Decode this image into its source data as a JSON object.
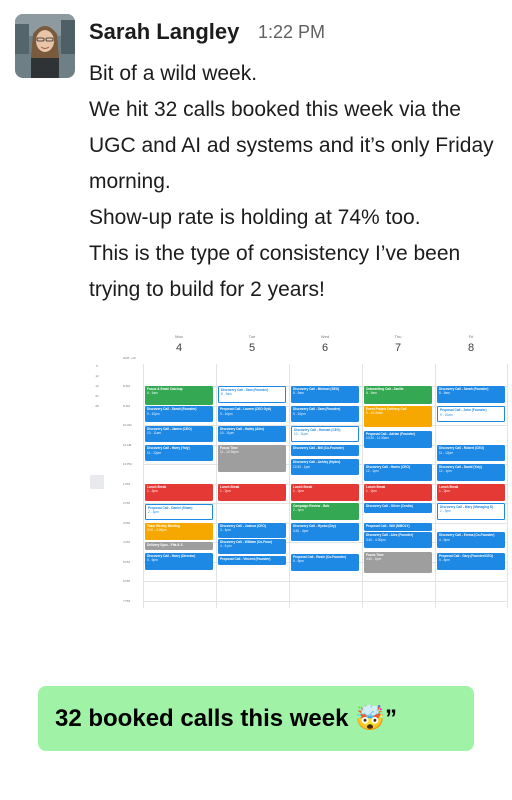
{
  "message": {
    "sender": "Sarah Langley",
    "time": "1:22 PM",
    "lines": [
      "Bit of a wild week.",
      "We hit 32 calls booked this week via the UGC and AI ad systems and it’s only Friday morning.",
      "Show-up rate is holding at 74% too.",
      "This is the type of consistency I’ve been trying to build for 2 years!"
    ]
  },
  "calendar": {
    "gmt_label": "GMT +10",
    "mini_dates": [
      "5",
      "12",
      "14",
      "21",
      "28"
    ],
    "days": [
      {
        "dow": "Mon",
        "num": "4"
      },
      {
        "dow": "Tue",
        "num": "5"
      },
      {
        "dow": "Wed",
        "num": "6"
      },
      {
        "dow": "Thu",
        "num": "7"
      },
      {
        "dow": "Fri",
        "num": "8"
      }
    ],
    "hours": [
      "8 AM",
      "9 AM",
      "10 AM",
      "11 AM",
      "12 PM",
      "1 PM",
      "2 PM",
      "3 PM",
      "4 PM",
      "5 PM",
      "6 PM",
      "7 PM"
    ],
    "colors": {
      "blue": "#1e88e5",
      "green": "#34a853",
      "red": "#e53935",
      "orange": "#f6a800",
      "gray": "#9e9e9e"
    },
    "events": [
      {
        "day": 0,
        "start": 8.0,
        "end": 8.95,
        "color": "green",
        "outline": false,
        "title": "Focus & Email Catchup",
        "sub": "8 - 9am"
      },
      {
        "day": 0,
        "start": 9.05,
        "end": 9.85,
        "color": "blue",
        "outline": false,
        "title": "Discovery Call - Sarah (Founder)",
        "sub": "9 - 10pm"
      },
      {
        "day": 0,
        "start": 10.05,
        "end": 10.85,
        "color": "blue",
        "outline": false,
        "title": "Discovery Call - James (CEO)",
        "sub": "10 - 11am"
      },
      {
        "day": 0,
        "start": 11.05,
        "end": 11.85,
        "color": "blue",
        "outline": false,
        "title": "Discovery Call - Harry (Yoly)",
        "sub": "11 - 12pm"
      },
      {
        "day": 0,
        "start": 13.0,
        "end": 13.9,
        "color": "red",
        "outline": false,
        "title": "Lunch Break",
        "sub": "1 - 2pm"
      },
      {
        "day": 0,
        "start": 14.05,
        "end": 14.85,
        "color": "blue",
        "outline": true,
        "title": "Proposal Call - Daniel (Sham)",
        "sub": "2 - 3pm"
      },
      {
        "day": 0,
        "start": 15.0,
        "end": 15.9,
        "color": "orange",
        "outline": false,
        "title": "Team Weekly Meeting",
        "sub": "3:00 - 4:00pm"
      },
      {
        "day": 0,
        "start": 16.0,
        "end": 16.4,
        "color": "gray",
        "outline": false,
        "title": "Delivery Sync - Fifa & S",
        "sub": ""
      },
      {
        "day": 0,
        "start": 16.55,
        "end": 17.45,
        "color": "blue",
        "outline": false,
        "title": "Discovery Call - Harry (Director)",
        "sub": "5 - 6pm"
      },
      {
        "day": 1,
        "start": 8.0,
        "end": 8.85,
        "color": "blue",
        "outline": true,
        "title": "Discovery Call - Sam (Founder)",
        "sub": "8 - 9am"
      },
      {
        "day": 1,
        "start": 9.05,
        "end": 9.85,
        "color": "blue",
        "outline": false,
        "title": "Proposal Call - Lauren (CEO Gyb)",
        "sub": "9 - 10pm"
      },
      {
        "day": 1,
        "start": 10.05,
        "end": 10.85,
        "color": "blue",
        "outline": false,
        "title": "Discovery Call - Hailey (Alex)",
        "sub": "10 - 11pm"
      },
      {
        "day": 1,
        "start": 11.0,
        "end": 12.4,
        "color": "gray",
        "outline": false,
        "title": "Focus Time",
        "sub": "11 - 12:30pm"
      },
      {
        "day": 1,
        "start": 13.0,
        "end": 13.9,
        "color": "red",
        "outline": false,
        "title": "Lunch Break",
        "sub": "1 - 2pm"
      },
      {
        "day": 1,
        "start": 15.0,
        "end": 15.8,
        "color": "blue",
        "outline": false,
        "title": "Discovery Call - Joshua (CEO)",
        "sub": "3 - 4pm"
      },
      {
        "day": 1,
        "start": 15.85,
        "end": 16.6,
        "color": "blue",
        "outline": false,
        "title": "Discovery Call - William (Co-Foun)",
        "sub": "4 - 5 pm"
      },
      {
        "day": 1,
        "start": 16.7,
        "end": 17.2,
        "color": "blue",
        "outline": false,
        "title": "Proposal Call - Vincent (Founder)",
        "sub": ""
      },
      {
        "day": 2,
        "start": 8.0,
        "end": 8.85,
        "color": "blue",
        "outline": false,
        "title": "Discovery Call - Michael (SEO)",
        "sub": "8 - 9am"
      },
      {
        "day": 2,
        "start": 9.05,
        "end": 9.85,
        "color": "blue",
        "outline": false,
        "title": "Discovery Call - Sam (Founder)",
        "sub": "9 - 10pm"
      },
      {
        "day": 2,
        "start": 10.05,
        "end": 10.85,
        "color": "blue",
        "outline": true,
        "title": "Discovery Call - Hannah (CEO)",
        "sub": "10 - 11pm"
      },
      {
        "day": 2,
        "start": 11.05,
        "end": 11.6,
        "color": "blue",
        "outline": false,
        "title": "Discovery Call - Bill (Co-Founder)",
        "sub": ""
      },
      {
        "day": 2,
        "start": 11.75,
        "end": 12.55,
        "color": "blue",
        "outline": false,
        "title": "Discovery Call - Ashley (Hydro)",
        "sub": "12:30 - 1pm"
      },
      {
        "day": 2,
        "start": 13.0,
        "end": 13.9,
        "color": "red",
        "outline": false,
        "title": "Lunch Break",
        "sub": "1 - 2pm"
      },
      {
        "day": 2,
        "start": 14.0,
        "end": 14.85,
        "color": "green",
        "outline": false,
        "title": "Campaign Review - Bob",
        "sub": "2 - 3pm"
      },
      {
        "day": 2,
        "start": 15.05,
        "end": 15.95,
        "color": "blue",
        "outline": false,
        "title": "Discovery Call - Hyuko (Dry)",
        "sub": "3:30 - 4pm"
      },
      {
        "day": 2,
        "start": 16.6,
        "end": 17.5,
        "color": "blue",
        "outline": false,
        "title": "Proposal Call - Rosie (Co-Founder)",
        "sub": "5 - 6pm"
      },
      {
        "day": 3,
        "start": 8.0,
        "end": 8.9,
        "color": "green",
        "outline": false,
        "title": "Onboarding Call - Zacille",
        "sub": "8 - 9am"
      },
      {
        "day": 3,
        "start": 9.0,
        "end": 10.1,
        "color": "orange",
        "outline": false,
        "title": "Event Project Delivery Call",
        "sub": "9 - 10:30am"
      },
      {
        "day": 3,
        "start": 10.3,
        "end": 11.2,
        "color": "blue",
        "outline": false,
        "title": "Proposal Call - Adrian (Founder)",
        "sub": "10:30 - 11:30am"
      },
      {
        "day": 3,
        "start": 12.0,
        "end": 12.85,
        "color": "blue",
        "outline": false,
        "title": "Discovery Call - Harris (CEO)",
        "sub": "12 - 1pm"
      },
      {
        "day": 3,
        "start": 13.0,
        "end": 13.9,
        "color": "red",
        "outline": false,
        "title": "Lunch Break",
        "sub": "1 - 2pm"
      },
      {
        "day": 3,
        "start": 14.0,
        "end": 14.5,
        "color": "blue",
        "outline": false,
        "title": "Discovery Call - Oliver (Credia)",
        "sub": ""
      },
      {
        "day": 3,
        "start": 15.0,
        "end": 15.45,
        "color": "blue",
        "outline": false,
        "title": "Proposal Call - Will (NIBOLY)",
        "sub": ""
      },
      {
        "day": 3,
        "start": 15.5,
        "end": 16.3,
        "color": "blue",
        "outline": false,
        "title": "Discovery Call - Alex (Founder)",
        "sub": "3:40 - 4:30pm"
      },
      {
        "day": 3,
        "start": 16.5,
        "end": 17.6,
        "color": "gray",
        "outline": false,
        "title": "Focus Time",
        "sub": "4:40 - 6pm"
      },
      {
        "day": 4,
        "start": 8.0,
        "end": 8.85,
        "color": "blue",
        "outline": false,
        "title": "Discovery Call - Sarah (Founder)",
        "sub": "8 - 9am"
      },
      {
        "day": 4,
        "start": 9.05,
        "end": 9.85,
        "color": "blue",
        "outline": true,
        "title": "Proposal Call - John (Founder)",
        "sub": "9 - 10am"
      },
      {
        "day": 4,
        "start": 11.05,
        "end": 11.85,
        "color": "blue",
        "outline": false,
        "title": "Discovery Call - Robert (CEO)",
        "sub": "11 - 12pm"
      },
      {
        "day": 4,
        "start": 12.0,
        "end": 12.85,
        "color": "blue",
        "outline": false,
        "title": "Discovery Call - David (Yoly)",
        "sub": "12 - 1pm"
      },
      {
        "day": 4,
        "start": 13.0,
        "end": 13.9,
        "color": "red",
        "outline": false,
        "title": "Lunch Break",
        "sub": "1 - 2pm"
      },
      {
        "day": 4,
        "start": 14.0,
        "end": 14.85,
        "color": "blue",
        "outline": true,
        "title": "Discovery Call - Mary (Managing D)",
        "sub": "2 - 3pm"
      },
      {
        "day": 4,
        "start": 15.5,
        "end": 16.3,
        "color": "blue",
        "outline": false,
        "title": "Discovery Call - Emma (Co-Founder)",
        "sub": "4 - 5pm"
      },
      {
        "day": 4,
        "start": 16.55,
        "end": 17.45,
        "color": "blue",
        "outline": false,
        "title": "Proposal Call - Gary (Founder/CEO)",
        "sub": "5 - 6pm"
      }
    ]
  },
  "banner": {
    "text": "32 booked calls this week 🤯”",
    "color": "#a0f3a6"
  }
}
